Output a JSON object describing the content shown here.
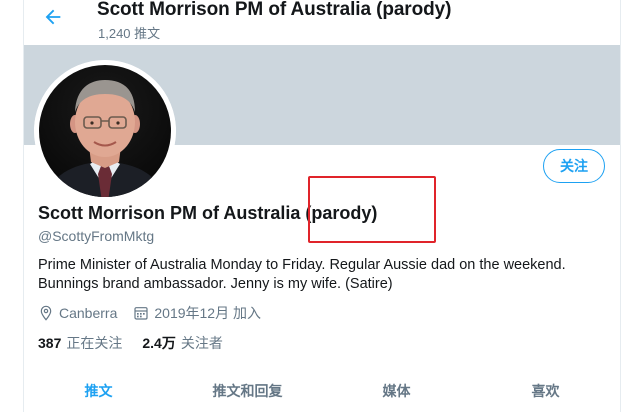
{
  "header": {
    "back_icon": "back-arrow-icon",
    "title": "Scott Morrison PM of Australia (parody)",
    "tweet_count": "1,240 推文"
  },
  "profile": {
    "name": "Scott Morrison PM of Australia (parody)",
    "handle": "@ScottyFromMktg",
    "bio": "Prime Minister of Australia Monday to Friday. Regular Aussie dad on the weekend. Bunnings brand ambassador. Jenny is my wife. (Satire)",
    "location": "Canberra",
    "joined": "2019年12月 加入",
    "following_count": "387",
    "following_label": "正在关注",
    "followers_count": "2.4万",
    "followers_label": "关注者",
    "follow_button": "关注"
  },
  "tabs": [
    {
      "label": "推文",
      "active": true
    },
    {
      "label": "推文和回复",
      "active": false
    },
    {
      "label": "媒体",
      "active": false
    },
    {
      "label": "喜欢",
      "active": false
    }
  ],
  "colors": {
    "accent": "#1da1f2",
    "banner": "#ccd6dd",
    "annotation": "#e0242a",
    "secondary_text": "#657786"
  }
}
